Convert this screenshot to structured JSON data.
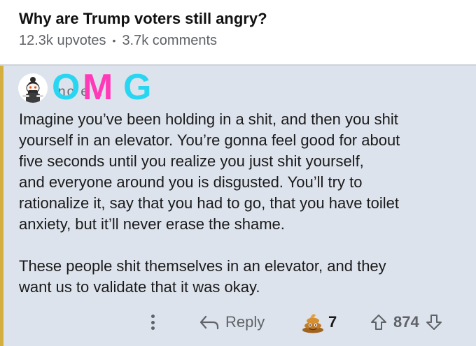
{
  "post": {
    "title": "Why are Trump voters still angry?",
    "upvotes": "12.3k upvotes",
    "separator": "•",
    "comments": "3.7k comments"
  },
  "comment": {
    "username_partial": "no  e   u",
    "sticker_text": [
      "O",
      "M",
      "G"
    ],
    "paragraphs": [
      "Imagine you’ve been holding in a shit, and then you shit\nyourself in an elevator. You’re gonna feel good for about\nfive seconds until you realize you just shit yourself,\nand everyone around you is disgusted. You’ll try to\nrationalize it, say that you had to go, that you have toilet\nanxiety, but it’ll never erase the shame.",
      "These people shit themselves in an elevator, and they\nwant us to validate that it was okay."
    ],
    "actions": {
      "more_icon": "more-vertical-icon",
      "reply_label": "Reply",
      "reply_icon": "reply-arrow-icon",
      "award_icon": "poop-award-icon",
      "award_count": "7",
      "upvote_icon": "upvote-arrow-icon",
      "score": "874",
      "downvote_icon": "downvote-arrow-icon"
    }
  },
  "colors": {
    "comment_background": "#dde3ec",
    "thread_line": "#d4ae3f",
    "sticker_cyan": "#29d6f2",
    "sticker_magenta": "#ff39b7",
    "muted_text": "#5f6368"
  }
}
